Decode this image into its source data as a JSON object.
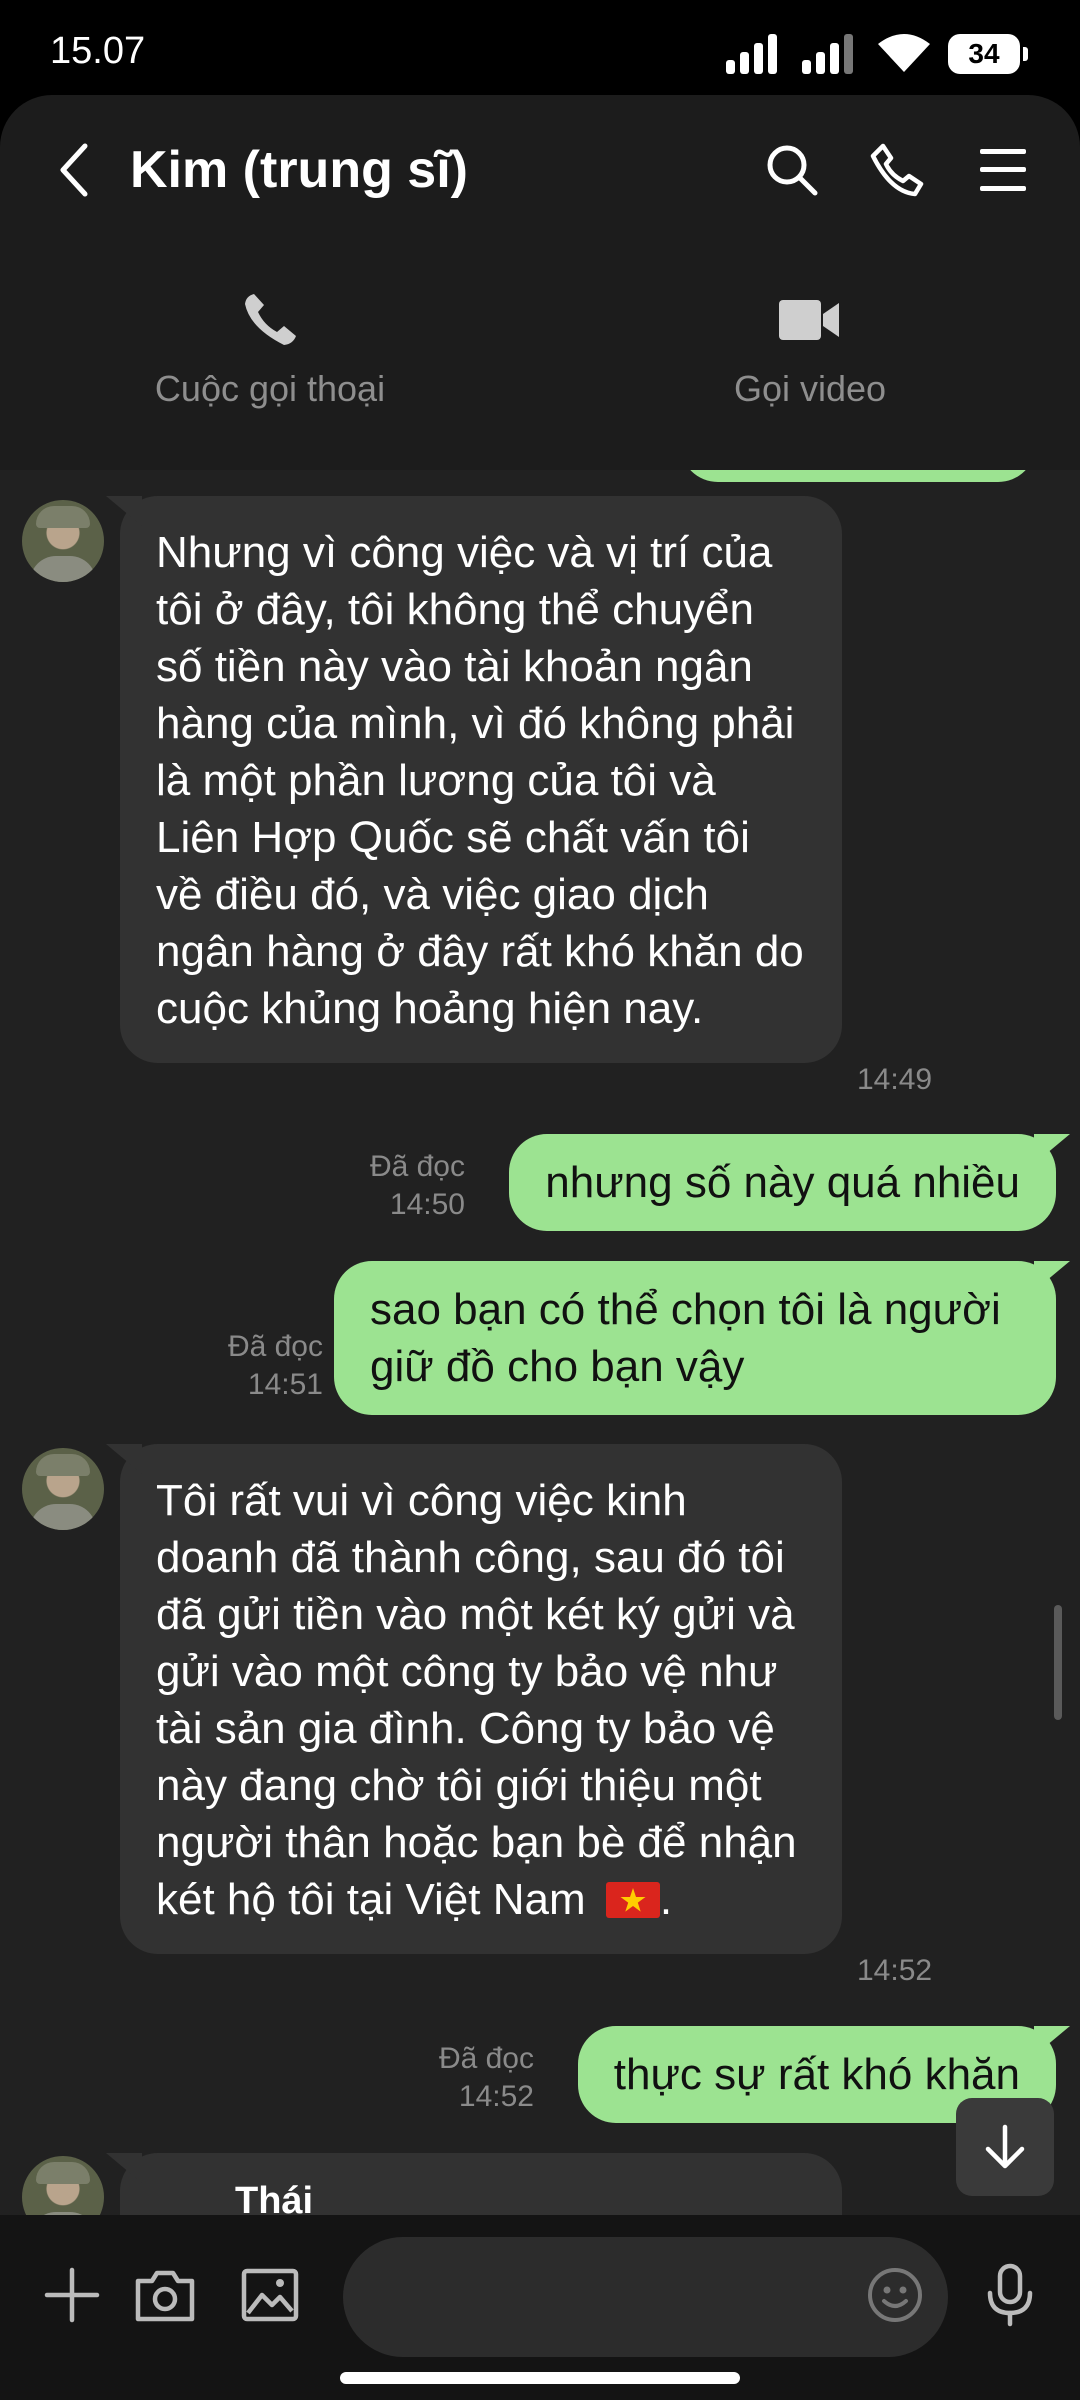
{
  "status_bar": {
    "time": "15.07",
    "battery": "34"
  },
  "header": {
    "title": "Kim (trung sĩ)",
    "voice_call_label": "Cuộc gọi thoại",
    "video_call_label": "Gọi video"
  },
  "messages": [
    {
      "type": "in",
      "text": "Nhưng vì công việc và vị trí của tôi ở đây, tôi không thể chuyển số tiền này vào tài khoản ngân hàng của mình, vì đó không phải là một phần lương của tôi và Liên Hợp Quốc sẽ chất vấn tôi về điều đó, và việc giao dịch ngân hàng ở đây rất khó khăn do cuộc khủng hoảng hiện nay.",
      "time": "14:49"
    },
    {
      "type": "out",
      "text": "nhưng số này quá nhiều",
      "status": "Đã đọc",
      "time": "14:50"
    },
    {
      "type": "out",
      "text": "sao bạn có thể chọn tôi là người giữ đồ cho bạn vậy",
      "status": "Đã đọc",
      "time": "14:51"
    },
    {
      "type": "in",
      "text": "Tôi rất vui vì công việc kinh doanh đã thành công, sau đó tôi đã gửi tiền vào một két ký gửi và gửi vào một công ty bảo vệ như tài sản gia đình. Công ty bảo vệ này đang chờ tôi giới thiệu một người thân hoặc bạn bè để nhận két hộ tôi tại Việt Nam",
      "flag": "🇻🇳",
      "text_end": ".",
      "time": "14:52"
    },
    {
      "type": "out",
      "text": "thực sự rất khó khăn",
      "status": "Đã đọc",
      "time": "14:52"
    },
    {
      "type": "in",
      "reply_name": "Thái"
    }
  ],
  "composer": {
    "placeholder": ""
  },
  "icons": [
    "back-icon",
    "search-icon",
    "phone-icon",
    "menu-icon",
    "video-icon",
    "plus-icon",
    "camera-icon",
    "image-icon",
    "emoji-icon",
    "mic-icon",
    "arrow-down-icon"
  ],
  "colors": {
    "outgoing_bubble": "#9ce391",
    "incoming_bubble": "#323232",
    "background": "#212121"
  }
}
